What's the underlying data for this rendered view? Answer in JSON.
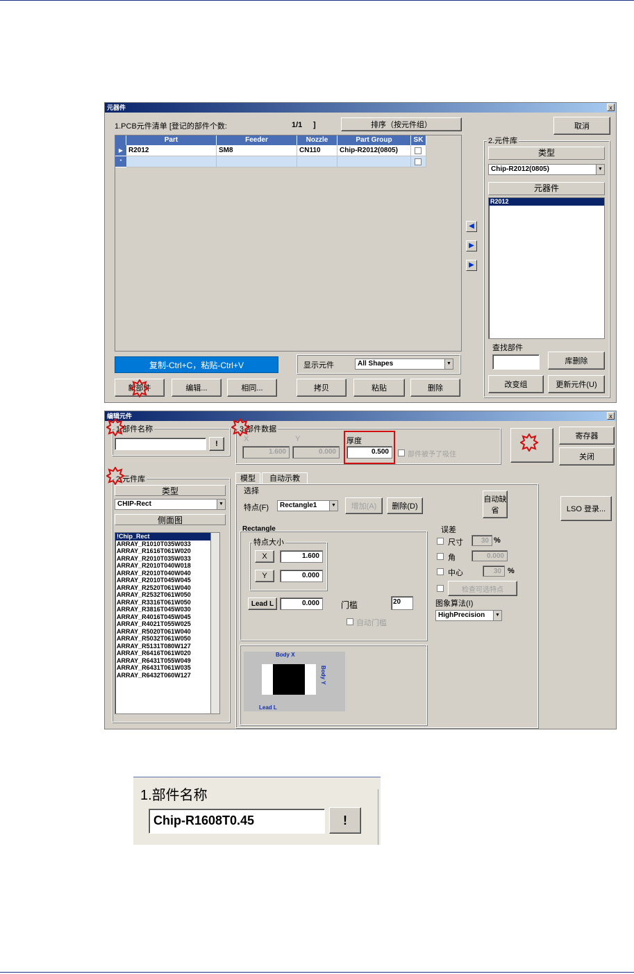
{
  "win1": {
    "title": "元器件",
    "close": "x",
    "pcb_list_label": "1.PCB元件清单 [登记的部件个数:",
    "pcb_count": "1/1",
    "pcb_bracket": "]",
    "sort_button": "排序（按元件组）",
    "cancel_button": "取消",
    "columns": [
      "Part",
      "Feeder",
      "Nozzle",
      "Part Group",
      "SK"
    ],
    "rows": [
      {
        "part": "R2012",
        "feeder": "SM8",
        "nozzle": "CN110",
        "group": "Chip-R2012(0805)"
      }
    ],
    "row_marker": "▶",
    "new_marker": "*",
    "lib_group": "2.元件库",
    "type_header": "类型",
    "type_value": "Chip-R2012(0805)",
    "part_header": "元器件",
    "part_items": [
      "R2012"
    ],
    "find_label": "查找部件",
    "lib_delete_button": "库删除",
    "change_group_button": "改变组",
    "update_part_button": "更新元件(U)",
    "copy_paste_hint": "复制-Ctrl+C，粘贴-Ctrl+V",
    "show_parts_label": "显示元件",
    "show_parts_value": "All Shapes",
    "add_part_button": "新部件",
    "edit_button": "编辑...",
    "same_button": "相同...",
    "copy_button": "拷贝",
    "paste_button": "粘贴",
    "delete_button": "删除"
  },
  "win2": {
    "title": "编辑元件",
    "close": "x",
    "name_group": "1.部件名称",
    "name_value": "",
    "bang_button": "!",
    "data_group": "3.部件数据",
    "x_label": "X",
    "y_label": "Y",
    "thick_label": "厚度",
    "x_value": "1.600",
    "y_value": "0.000",
    "thick_value": "0.500",
    "sticky_check": "部件被予了吸住",
    "register_button": "寄存器",
    "close_button": "关闭",
    "lib_group": "2.元件库",
    "type_header": "类型",
    "type_value": "CHIP-Rect",
    "side_header": "侧面图",
    "lib_items": [
      "!Chip_Rect",
      "ARRAY_R1010T035W033",
      "ARRAY_R1616T061W020",
      "ARRAY_R2010T035W033",
      "ARRAY_R2010T040W018",
      "ARRAY_R2010T040W040",
      "ARRAY_R2010T045W045",
      "ARRAY_R2520T061W040",
      "ARRAY_R2532T061W050",
      "ARRAY_R3316T061W050",
      "ARRAY_R3816T045W030",
      "ARRAY_R4016T045W045",
      "ARRAY_R4021T055W025",
      "ARRAY_R5020T061W040",
      "ARRAY_R5032T061W050",
      "ARRAY_R5131T080W127",
      "ARRAY_R6416T061W020",
      "ARRAY_R6431T055W049",
      "ARRAY_R6431T061W035",
      "ARRAY_R6432T060W127"
    ],
    "tab_model": "模型",
    "tab_auto": "自动示教",
    "select_label": "选择",
    "feature_label": "特点(F)",
    "feature_value": "Rectangle1",
    "add_button": "增加(A)",
    "delete_button": "删除(D)",
    "default_button": "自动缺省",
    "lso_button": "LSO 登录...",
    "rect_label": "Rectangle",
    "feature_size_label": "特点大小",
    "fx_label": "X",
    "fy_label": "Y",
    "fx_value": "1.600",
    "fy_value": "0.000",
    "lead_label": "Lead L",
    "lead_value": "0.000",
    "threshold_label": "门槛",
    "threshold_value": "20",
    "auto_threshold": "自动门槛",
    "tol_label": "误差",
    "size_label": "尺寸",
    "size_value": "30",
    "pct1": "%",
    "angle_label": "角",
    "angle_value": "0.000",
    "center_label": "中心",
    "center_value": "30",
    "pct2": "%",
    "check_feature": "检查可选特点",
    "algo_label": "图象算法(I)",
    "algo_value": "HighPrecision",
    "body_x": "Body X",
    "body_y": "Body Y",
    "lead_l": "Lead L"
  },
  "zoom": {
    "title": "1.部件名称",
    "value": "Chip-R1608T0.45",
    "bang": "!"
  },
  "colors": {
    "dialog": "#d4d0c8",
    "titlebar": "#0a246a",
    "header": "#4a6eb5",
    "highlight": "#0078d7",
    "annot": "#d01010"
  }
}
